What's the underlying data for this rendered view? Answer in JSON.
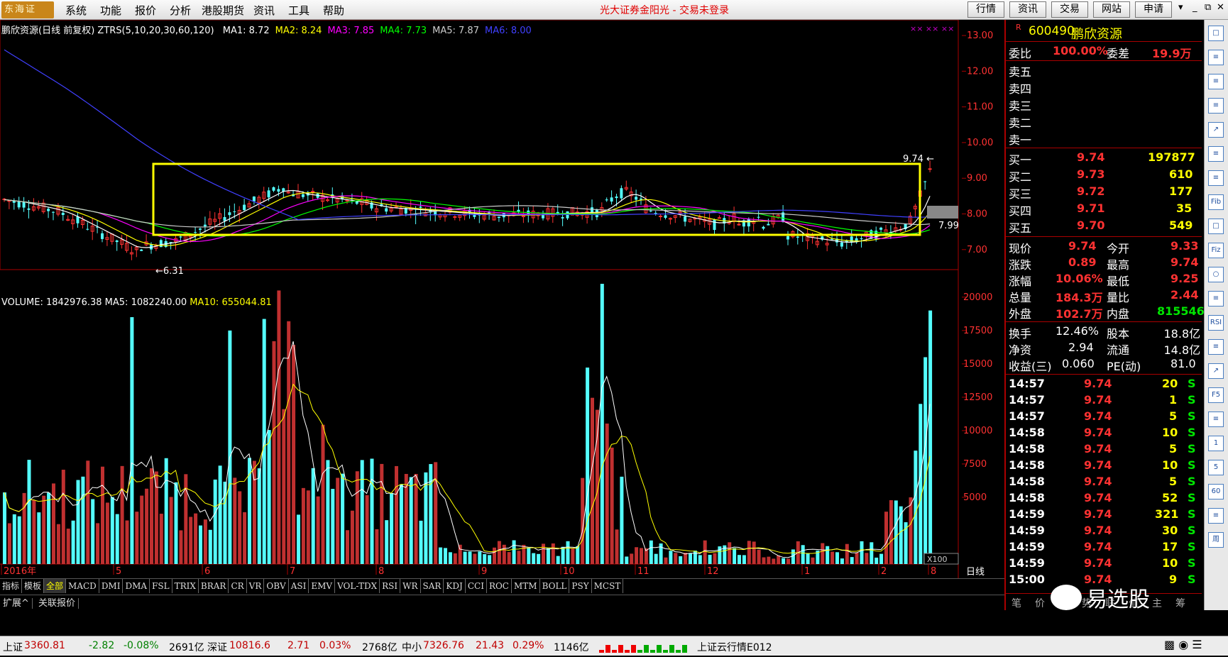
{
  "menubar": {
    "logo": "东海证",
    "items": [
      "系统",
      "功能",
      "报价",
      "分析",
      "港股期货",
      "资讯",
      "工具",
      "帮助"
    ],
    "title": "光大证券金阳光 - 交易未登录",
    "buttons": [
      "行情",
      "资讯",
      "交易",
      "网站",
      "申请"
    ]
  },
  "chart_header": {
    "stock": "鹏欣资源(日线 前复权)",
    "indicator": "ZTRS(5,10,20,30,60,120)",
    "ma": [
      {
        "label": "MA1: 8.72",
        "color": "#ffffff"
      },
      {
        "label": "MA2: 8.24",
        "color": "#ffff00"
      },
      {
        "label": "MA3: 7.85",
        "color": "#ff00ff"
      },
      {
        "label": "MA4: 7.73",
        "color": "#00ff00"
      },
      {
        "label": "MA5: 7.87",
        "color": "#cccccc"
      },
      {
        "label": "MA6: 8.00",
        "color": "#4040ff"
      }
    ]
  },
  "volume_header": {
    "vol": "VOLUME: 1842976.38",
    "ma5": "MA5: 1082240.00",
    "ma10": "MA10: 655044.81"
  },
  "price_axis": [
    "13.00",
    "12.00",
    "11.00",
    "10.00",
    "9.00",
    "8.00",
    "7.00"
  ],
  "volume_axis": [
    "20000",
    "17500",
    "15000",
    "12500",
    "10000",
    "7500",
    "5000"
  ],
  "annotations": {
    "high": "9.74",
    "low": "6.31",
    "cur": "7.99",
    "x100": "X100",
    "period": "日线"
  },
  "x_labels": [
    "2016年",
    "5",
    "6",
    "7",
    "8",
    "9",
    "10",
    "11",
    "12",
    "1",
    "2",
    "8"
  ],
  "indicator_tabs": [
    "指标",
    "模板",
    "全部",
    "MACD",
    "DMI",
    "DMA",
    "FSL",
    "TRIX",
    "BRAR",
    "CR",
    "VR",
    "OBV",
    "ASI",
    "EMV",
    "VOL-TDX",
    "RSI",
    "WR",
    "SAR",
    "KDJ",
    "CCI",
    "ROC",
    "MTM",
    "BOLL",
    "PSY",
    "MCST"
  ],
  "ext_tabs": [
    "扩展^",
    "关联报价"
  ],
  "quote": {
    "code": "600490",
    "name": "鹏欣资源",
    "weibi_label": "委比",
    "weibi": "100.00%",
    "weicha_label": "委差",
    "weicha": "19.9万",
    "sell": [
      {
        "l": "卖五"
      },
      {
        "l": "卖四"
      },
      {
        "l": "卖三"
      },
      {
        "l": "卖二"
      },
      {
        "l": "卖一"
      }
    ],
    "buy": [
      {
        "l": "买一",
        "p": "9.74",
        "v": "197877"
      },
      {
        "l": "买二",
        "p": "9.73",
        "v": "610"
      },
      {
        "l": "买三",
        "p": "9.72",
        "v": "177"
      },
      {
        "l": "买四",
        "p": "9.71",
        "v": "35"
      },
      {
        "l": "买五",
        "p": "9.70",
        "v": "549"
      }
    ],
    "stats": [
      {
        "l1": "现价",
        "v1": "9.74",
        "l2": "今开",
        "v2": "9.33"
      },
      {
        "l1": "涨跌",
        "v1": "0.89",
        "l2": "最高",
        "v2": "9.74"
      },
      {
        "l1": "涨幅",
        "v1": "10.06%",
        "l2": "最低",
        "v2": "9.25"
      },
      {
        "l1": "总量",
        "v1": "184.3万",
        "l2": "量比",
        "v2": "2.44"
      },
      {
        "l1": "外盘",
        "v1": "102.7万",
        "l2": "内盘",
        "v2": "815546"
      }
    ],
    "fund": [
      {
        "l1": "换手",
        "v1": "12.46%",
        "l2": "股本",
        "v2": "18.8亿"
      },
      {
        "l1": "净资",
        "v1": "2.94",
        "l2": "流通",
        "v2": "14.8亿"
      },
      {
        "l1": "收益(三)",
        "v1": "0.060",
        "l2": "PE(动)",
        "v2": "81.0"
      }
    ],
    "ticks": [
      {
        "t": "14:57",
        "p": "9.74",
        "v": "20",
        "s": "S"
      },
      {
        "t": "14:57",
        "p": "9.74",
        "v": "1",
        "s": "S"
      },
      {
        "t": "14:57",
        "p": "9.74",
        "v": "5",
        "s": "S"
      },
      {
        "t": "14:58",
        "p": "9.74",
        "v": "10",
        "s": "S"
      },
      {
        "t": "14:58",
        "p": "9.74",
        "v": "5",
        "s": "S"
      },
      {
        "t": "14:58",
        "p": "9.74",
        "v": "10",
        "s": "S"
      },
      {
        "t": "14:58",
        "p": "9.74",
        "v": "5",
        "s": "S"
      },
      {
        "t": "14:58",
        "p": "9.74",
        "v": "52",
        "s": "S"
      },
      {
        "t": "14:59",
        "p": "9.74",
        "v": "321",
        "s": "S"
      },
      {
        "t": "14:59",
        "p": "9.74",
        "v": "30",
        "s": "S"
      },
      {
        "t": "14:59",
        "p": "9.74",
        "v": "17",
        "s": "S"
      },
      {
        "t": "14:59",
        "p": "9.74",
        "v": "10",
        "s": "S"
      },
      {
        "t": "15:00",
        "p": "9.74",
        "v": "9",
        "s": "S"
      }
    ],
    "bottom_tabs": [
      "笔",
      "价",
      "细",
      "势",
      "联",
      "值",
      "主",
      "筹"
    ]
  },
  "sidebar": [
    "□",
    "≡",
    "≡",
    "≡",
    "↗",
    "≡",
    "≡",
    "Fib",
    "□",
    "Fiz",
    "○",
    "≡",
    "RSI",
    "≡",
    "↗",
    "F5",
    "≡",
    "1",
    "5",
    "60",
    "≡",
    "周"
  ],
  "status": {
    "sh_label": "上证",
    "sh": "3360.81",
    "sh_chg": "-2.82",
    "sh_pct": "-0.08%",
    "sh_amt": "2691亿",
    "sz_label": "深证",
    "sz": "10816.6",
    "sz_chg": "2.71",
    "sz_pct": "0.03%",
    "sz_amt": "2768亿",
    "zx_label": "中小",
    "zx": "7326.76",
    "zx_chg": "21.43",
    "zx_pct": "0.29%",
    "zx_amt": "1146亿",
    "cloud": "上证云行情E012"
  },
  "watermark": "易选股"
}
